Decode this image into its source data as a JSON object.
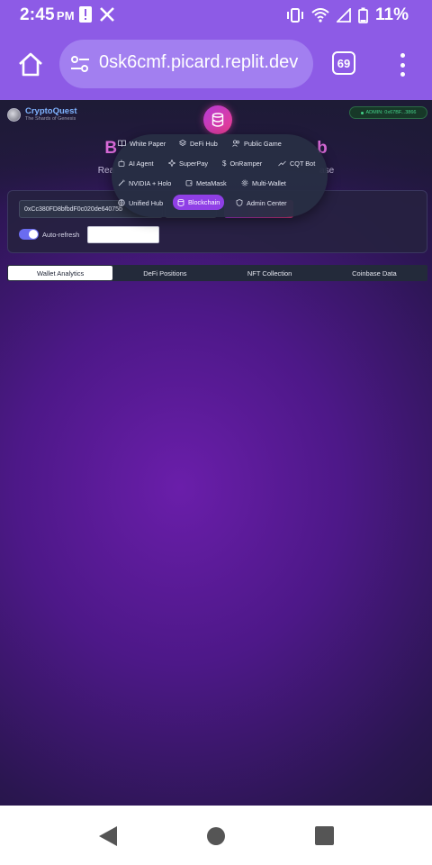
{
  "status_bar": {
    "time": "2:45",
    "ampm": "PM",
    "battery": "11%"
  },
  "browser": {
    "url": "0sk6cmf.picard.replit.dev",
    "tab_count": "69"
  },
  "app": {
    "logo_name": "CryptoQuest",
    "logo_tagline": "The Shards of Genesis",
    "admin_badge": "ADMIN: 0x67BF...3866",
    "hero_title_left": "B",
    "hero_title_right": "b",
    "hero_sub_left": "Rea",
    "hero_sub_right": "ase"
  },
  "controls": {
    "address_value": "0xCc380FD8bfbdF0c020de64075b",
    "auto_refresh_label": "Auto-refresh",
    "auto_refresh_on": true,
    "interval_value": ""
  },
  "tabs": [
    {
      "label": "Wallet Analytics",
      "active": true
    },
    {
      "label": "DeFi Positions",
      "active": false
    },
    {
      "label": "NFT Collection",
      "active": false
    },
    {
      "label": "Coinbase Data",
      "active": false
    }
  ],
  "nav_menu": {
    "items": [
      {
        "label": "White Paper",
        "icon": "book-icon"
      },
      {
        "label": "DeFi Hub",
        "icon": "layers-icon"
      },
      {
        "label": "Public Game",
        "icon": "users-icon"
      },
      {
        "label": "AI Agent",
        "icon": "bot-icon"
      },
      {
        "label": "SuperPay",
        "icon": "sparkle-icon"
      },
      {
        "label": "OnRamper",
        "icon": "dollar-icon"
      },
      {
        "label": "CQT Bot",
        "icon": "trending-up-icon"
      },
      {
        "label": "NVIDIA + Holo",
        "icon": "magic-wand-icon"
      },
      {
        "label": "MetaMask",
        "icon": "wallet-icon"
      },
      {
        "label": "Multi-Wallet",
        "icon": "gear-icon"
      },
      {
        "label": "Unified Hub",
        "icon": "globe-icon"
      },
      {
        "label": "Blockchain",
        "icon": "database-icon",
        "active": true
      },
      {
        "label": "Admin Center",
        "icon": "shield-icon"
      }
    ]
  },
  "colors": {
    "browser_chrome": "#8d5be6",
    "accent_pink": "#e2357e",
    "accent_purple": "#8f3fe6",
    "admin_green": "#44d28a"
  }
}
